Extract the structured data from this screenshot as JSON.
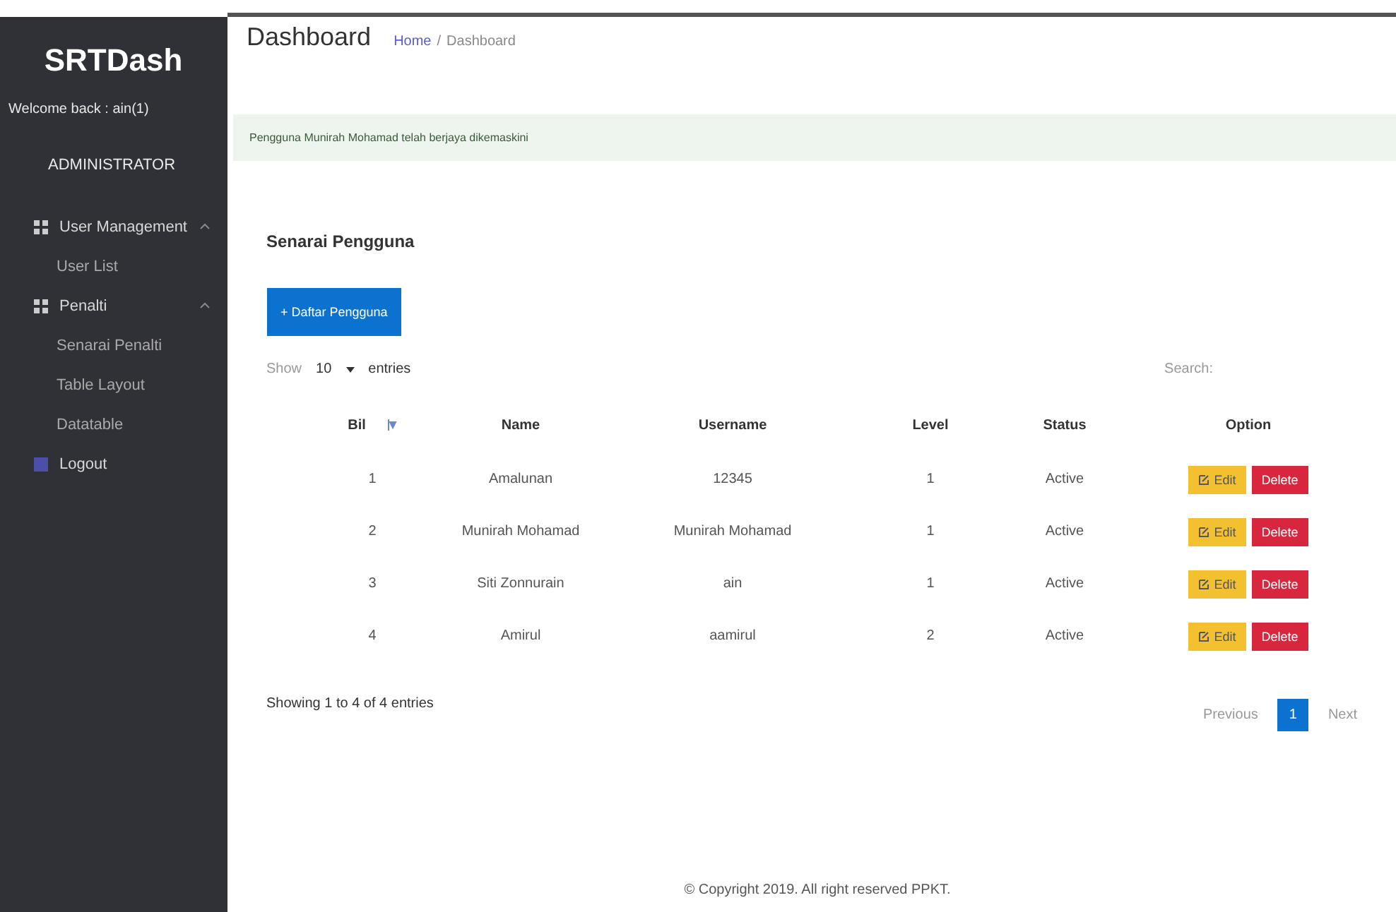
{
  "sidebar": {
    "logo": "SRTDash",
    "welcome": "Welcome back : ain(1)",
    "role": "ADMINISTRATOR",
    "items": [
      {
        "label": "User Management",
        "kind": "group",
        "expanded": true,
        "children": [
          {
            "label": "User List"
          }
        ]
      },
      {
        "label": "Penalti",
        "kind": "group",
        "expanded": true,
        "children": [
          {
            "label": "Senarai Penalti"
          },
          {
            "label": "Table Layout"
          },
          {
            "label": "Datatable"
          }
        ]
      },
      {
        "label": "Logout",
        "kind": "link"
      }
    ]
  },
  "header": {
    "title": "Dashboard",
    "breadcrumb": [
      {
        "label": "Home",
        "link": true
      },
      {
        "label": "Dashboard",
        "link": false
      }
    ],
    "separator": "/"
  },
  "alert": "Pengguna Munirah Mohamad telah berjaya dikemaskini",
  "card": {
    "title": "Senarai Pengguna",
    "add_button": "+ Daftar Pengguna",
    "show_label": "Show",
    "page_size": "10",
    "entries_label": "entries",
    "search_label": "Search:",
    "columns": [
      {
        "label": "Bil",
        "sorted": true
      },
      {
        "label": "Name",
        "sorted": false
      },
      {
        "label": "Username",
        "sorted": false
      },
      {
        "label": "Level",
        "sorted": false
      },
      {
        "label": "Status",
        "sorted": false
      },
      {
        "label": "Option",
        "sorted": false
      }
    ],
    "rows": [
      {
        "bil": "1",
        "name": "Amalunan",
        "username": "12345",
        "level": "1",
        "status": "Active",
        "edit": "Edit",
        "delete": "Delete"
      },
      {
        "bil": "2",
        "name": "Munirah Mohamad",
        "username": "Munirah Mohamad",
        "level": "1",
        "status": "Active",
        "edit": "Edit",
        "delete": "Delete"
      },
      {
        "bil": "3",
        "name": "Siti Zonnurain",
        "username": "ain",
        "level": "1",
        "status": "Active",
        "edit": "Edit",
        "delete": "Delete"
      },
      {
        "bil": "4",
        "name": "Amirul",
        "username": "aamirul",
        "level": "2",
        "status": "Active",
        "edit": "Edit",
        "delete": "Delete"
      }
    ],
    "info": "Showing 1 to 4 of 4 entries",
    "pagination": [
      {
        "label": "Previous",
        "selected": false
      },
      {
        "label": "1",
        "selected": true
      },
      {
        "label": "Next",
        "selected": false
      }
    ]
  },
  "footer": "© Copyright 2019. All right reserved PPKT."
}
